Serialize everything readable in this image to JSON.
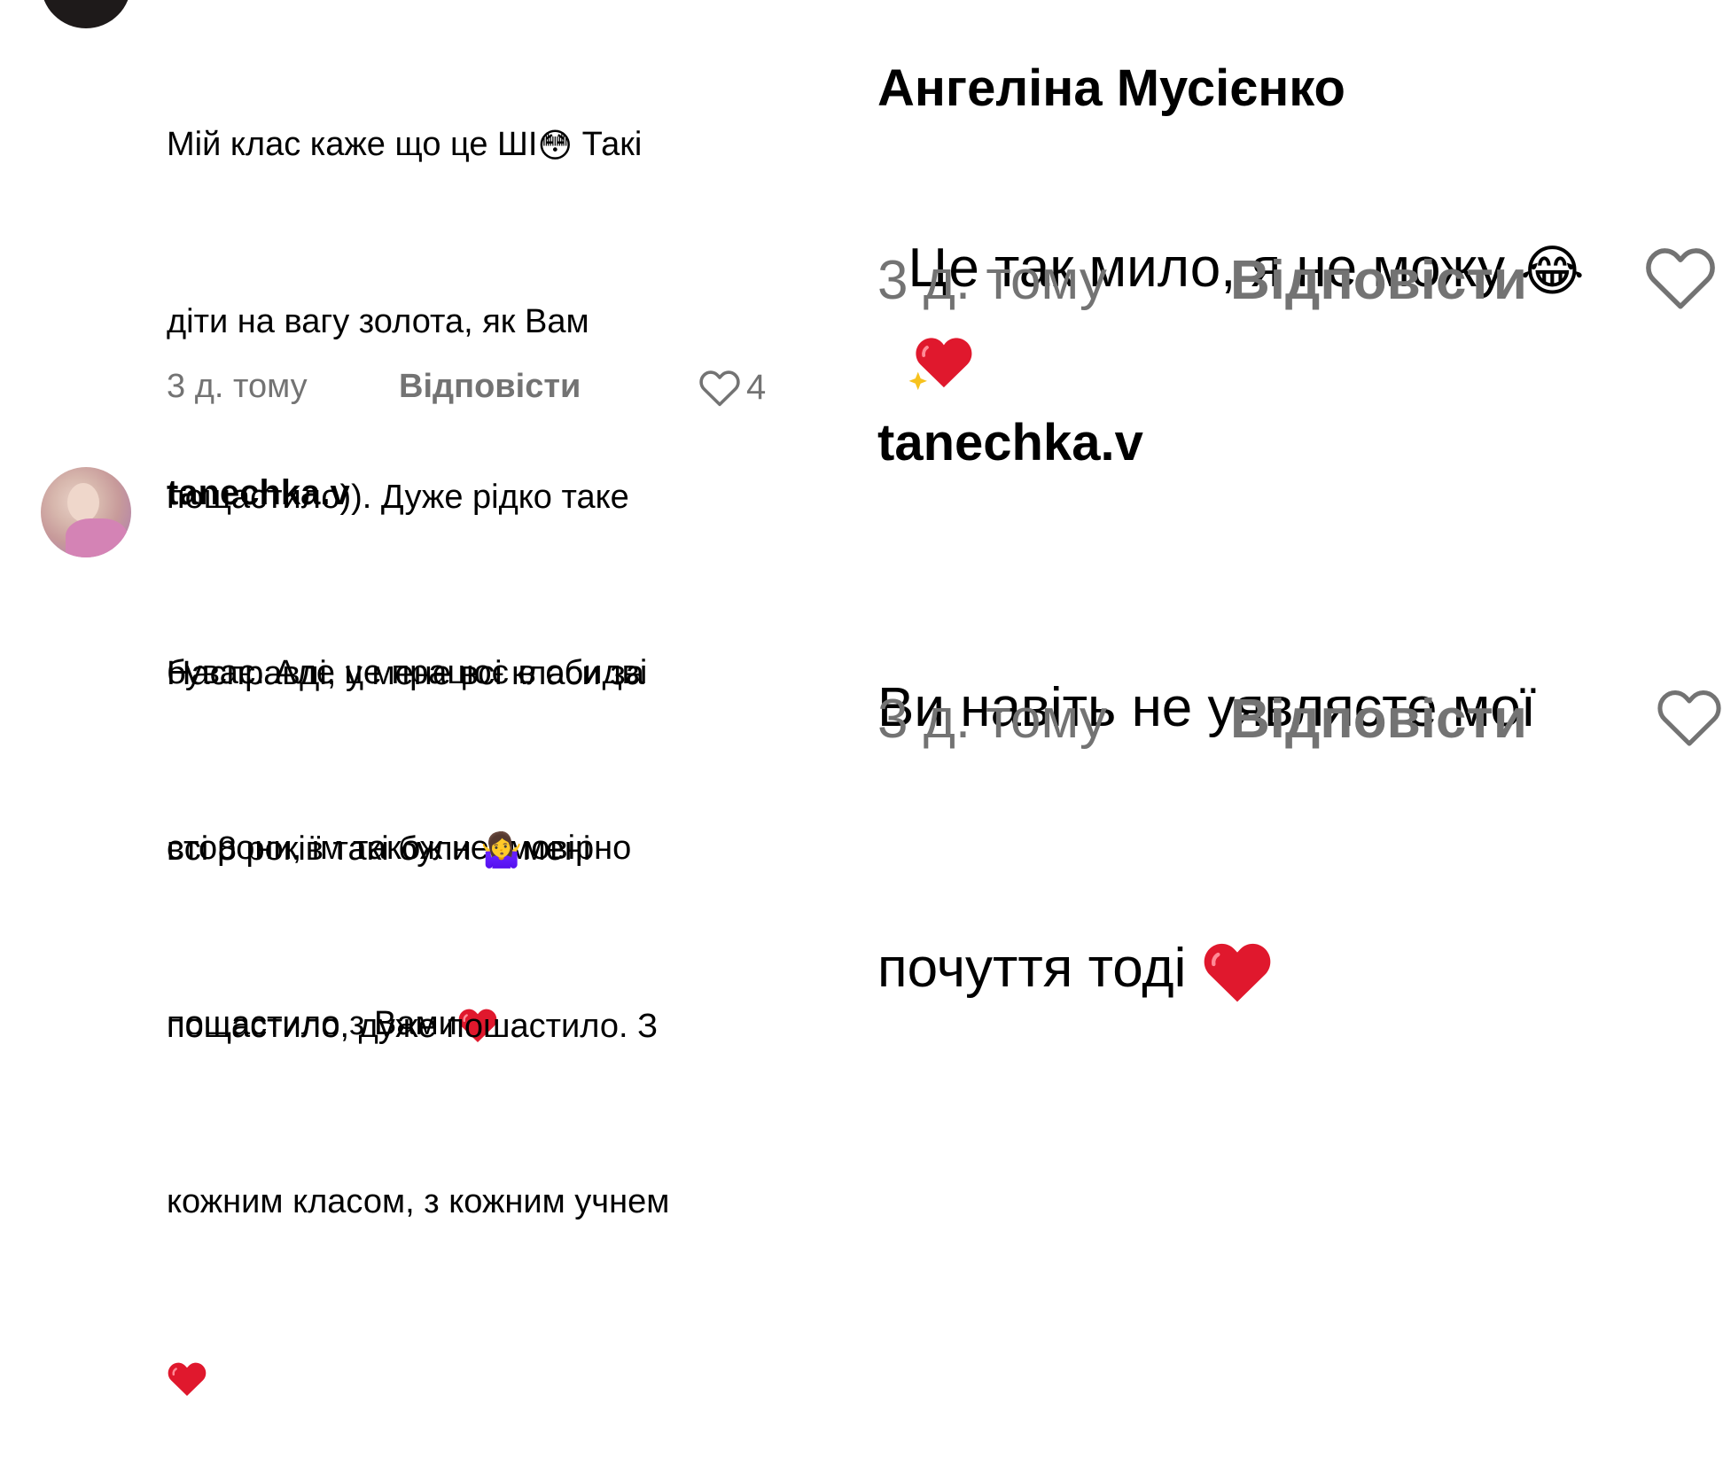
{
  "left": {
    "comment1": {
      "lines": [
        "Мій клас каже що це ШІ",
        "діти на вагу золота, як Вам",
        "пощастило)). Дуже рідко таке",
        "буває. Але це працює в обидві",
        "сторони, їм також неймовірно",
        "пощастило з Вами"
      ],
      "after_emoji": " Такі",
      "emoji_flushed": "😳",
      "time": "3 д. тому",
      "reply": "Відповісти",
      "likes": "4"
    },
    "comment2": {
      "username": "tanechka.v",
      "lines": [
        "Насправді, у мене всі класи за",
        "всі 8 років такі були ",
        "мені",
        "пощастило, дуже пошастило. З",
        "кожним класом, з кожним учнем"
      ],
      "emoji_shrug": "🤷‍♀️"
    }
  },
  "right": {
    "reply1": {
      "username": "Ангеліна Мусієнко",
      "text": "Це так мило, я не можу ",
      "emoji_joy": "😂",
      "time": "3 д. тому",
      "reply": "Відповісти"
    },
    "reply2": {
      "username": "tanechka.v",
      "line1": "Ви навіть не уявляєте мої",
      "line2": "почуття тоді ",
      "time": "3 д. тому",
      "reply": "Відповісти"
    }
  },
  "colors": {
    "text": "#000000",
    "muted": "#737373",
    "heart": "#e0182d"
  }
}
